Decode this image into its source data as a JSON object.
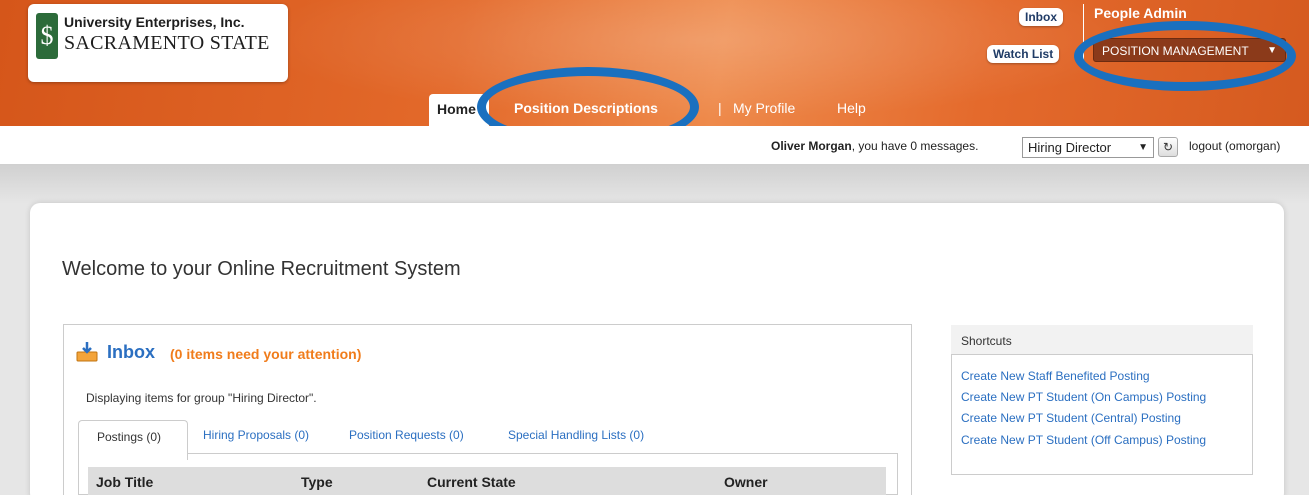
{
  "branding": {
    "org_line1": "University Enterprises, Inc.",
    "org_line2": "SACRAMENTO STATE",
    "logo_glyph": "$"
  },
  "header": {
    "inbox_label": "Inbox",
    "watch_list_label": "Watch List",
    "product_name": "People Admin",
    "module_select": "POSITION MANAGEMENT",
    "module_caret": "▼"
  },
  "nav": {
    "home": "Home",
    "position_descriptions": "Position Descriptions",
    "separator": "|",
    "my_profile": "My Profile",
    "help": "Help"
  },
  "userbar": {
    "user_name": "Oliver Morgan",
    "messages_text": ", you have 0 messages.",
    "role": "Hiring Director",
    "role_caret": "▼",
    "refresh_glyph": "↻",
    "logout": "logout (omorgan)"
  },
  "main": {
    "welcome": "Welcome to your Online Recruitment System",
    "inbox": {
      "title": "Inbox",
      "count_text": "(0 items need your attention)",
      "display_text": "Displaying items for group \"Hiring Director\".",
      "tabs": [
        {
          "label": "Postings (0)"
        },
        {
          "label": "Hiring Proposals (0)"
        },
        {
          "label": "Position Requests (0)"
        },
        {
          "label": "Special Handling Lists (0)"
        }
      ],
      "columns": [
        "Job Title",
        "Type",
        "Current State",
        "Owner"
      ]
    },
    "shortcuts": {
      "title": "Shortcuts",
      "links": [
        "Create New Staff Benefited Posting",
        "Create New PT Student (On Campus) Posting",
        "Create New PT Student (Central) Posting",
        "Create New PT Student (Off Campus) Posting"
      ]
    }
  },
  "colors": {
    "header_orange": "#e3692a",
    "link_blue": "#2b6fc1",
    "attention_orange": "#f07c1b",
    "highlight_ring": "#1a70bf",
    "module_select_bg": "#8b3a1a"
  }
}
